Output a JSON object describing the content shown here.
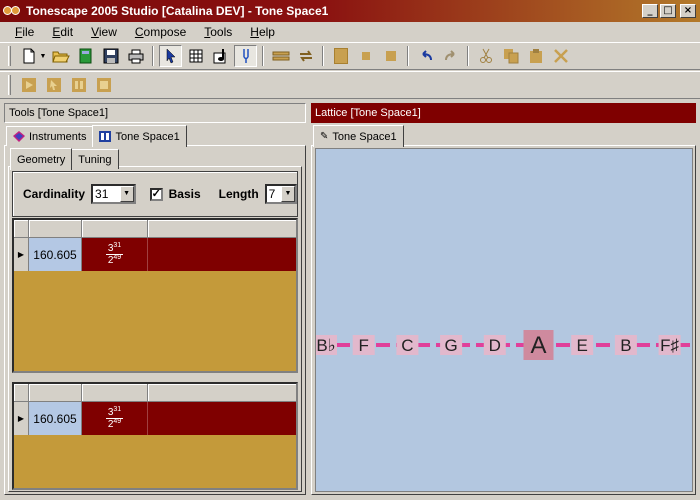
{
  "window": {
    "title": "Tonescape 2005 Studio [Catalina DEV]  -  Tone Space1",
    "buttons": [
      "_",
      "□",
      "×"
    ]
  },
  "menu": [
    "File",
    "Edit",
    "View",
    "Compose",
    "Tools",
    "Help"
  ],
  "toolbar1": {
    "icons": [
      "new-icon",
      "open-icon",
      "green-book-icon",
      "save-icon",
      "print-icon",
      "select-arrow-icon",
      "grid-icon",
      "note-icon",
      "tuning-fork-icon",
      "split-icon",
      "loop-icon",
      "stop-icon",
      "small-stop-icon",
      "gold-stop-icon",
      "undo-icon",
      "redo-icon",
      "cut-icon",
      "copy-icon",
      "paste-icon",
      "delete-icon"
    ]
  },
  "toolbar2": {
    "icons": [
      "play-icon",
      "play-from-cursor-icon",
      "pause-icon",
      "stop-icon"
    ]
  },
  "left": {
    "panel_title": "Tools  [Tone Space1]",
    "tabs": [
      "Instruments",
      "Tone Space1"
    ],
    "subtabs": [
      "Geometry",
      "Tuning"
    ],
    "cardinality_label": "Cardinality",
    "cardinality_value": "31",
    "basis_label": "Basis",
    "basis_checked": true,
    "length_label": "Length",
    "length_value": "7",
    "grid1": {
      "rows": [
        {
          "value": "160.605",
          "ratio_num_base": "3",
          "ratio_num_exp": "31",
          "ratio_den_base": "2",
          "ratio_den_exp": "49"
        }
      ]
    },
    "grid2": {
      "rows": [
        {
          "value": "160.605",
          "ratio_num_base": "3",
          "ratio_num_exp": "31",
          "ratio_den_base": "2",
          "ratio_den_exp": "49"
        }
      ]
    }
  },
  "right": {
    "panel_title": "Lattice  [Tone Space1]",
    "tab": "Tone Space1",
    "notes": [
      "B♭",
      "F",
      "C",
      "G",
      "D",
      "A",
      "E",
      "B",
      "F♯"
    ],
    "highlighted_note": "A",
    "colors": {
      "line": "#e0409a",
      "note_box": "#e2b8cc",
      "highlight_box": "#cf8a9e",
      "background": "#b3c7e0"
    }
  }
}
